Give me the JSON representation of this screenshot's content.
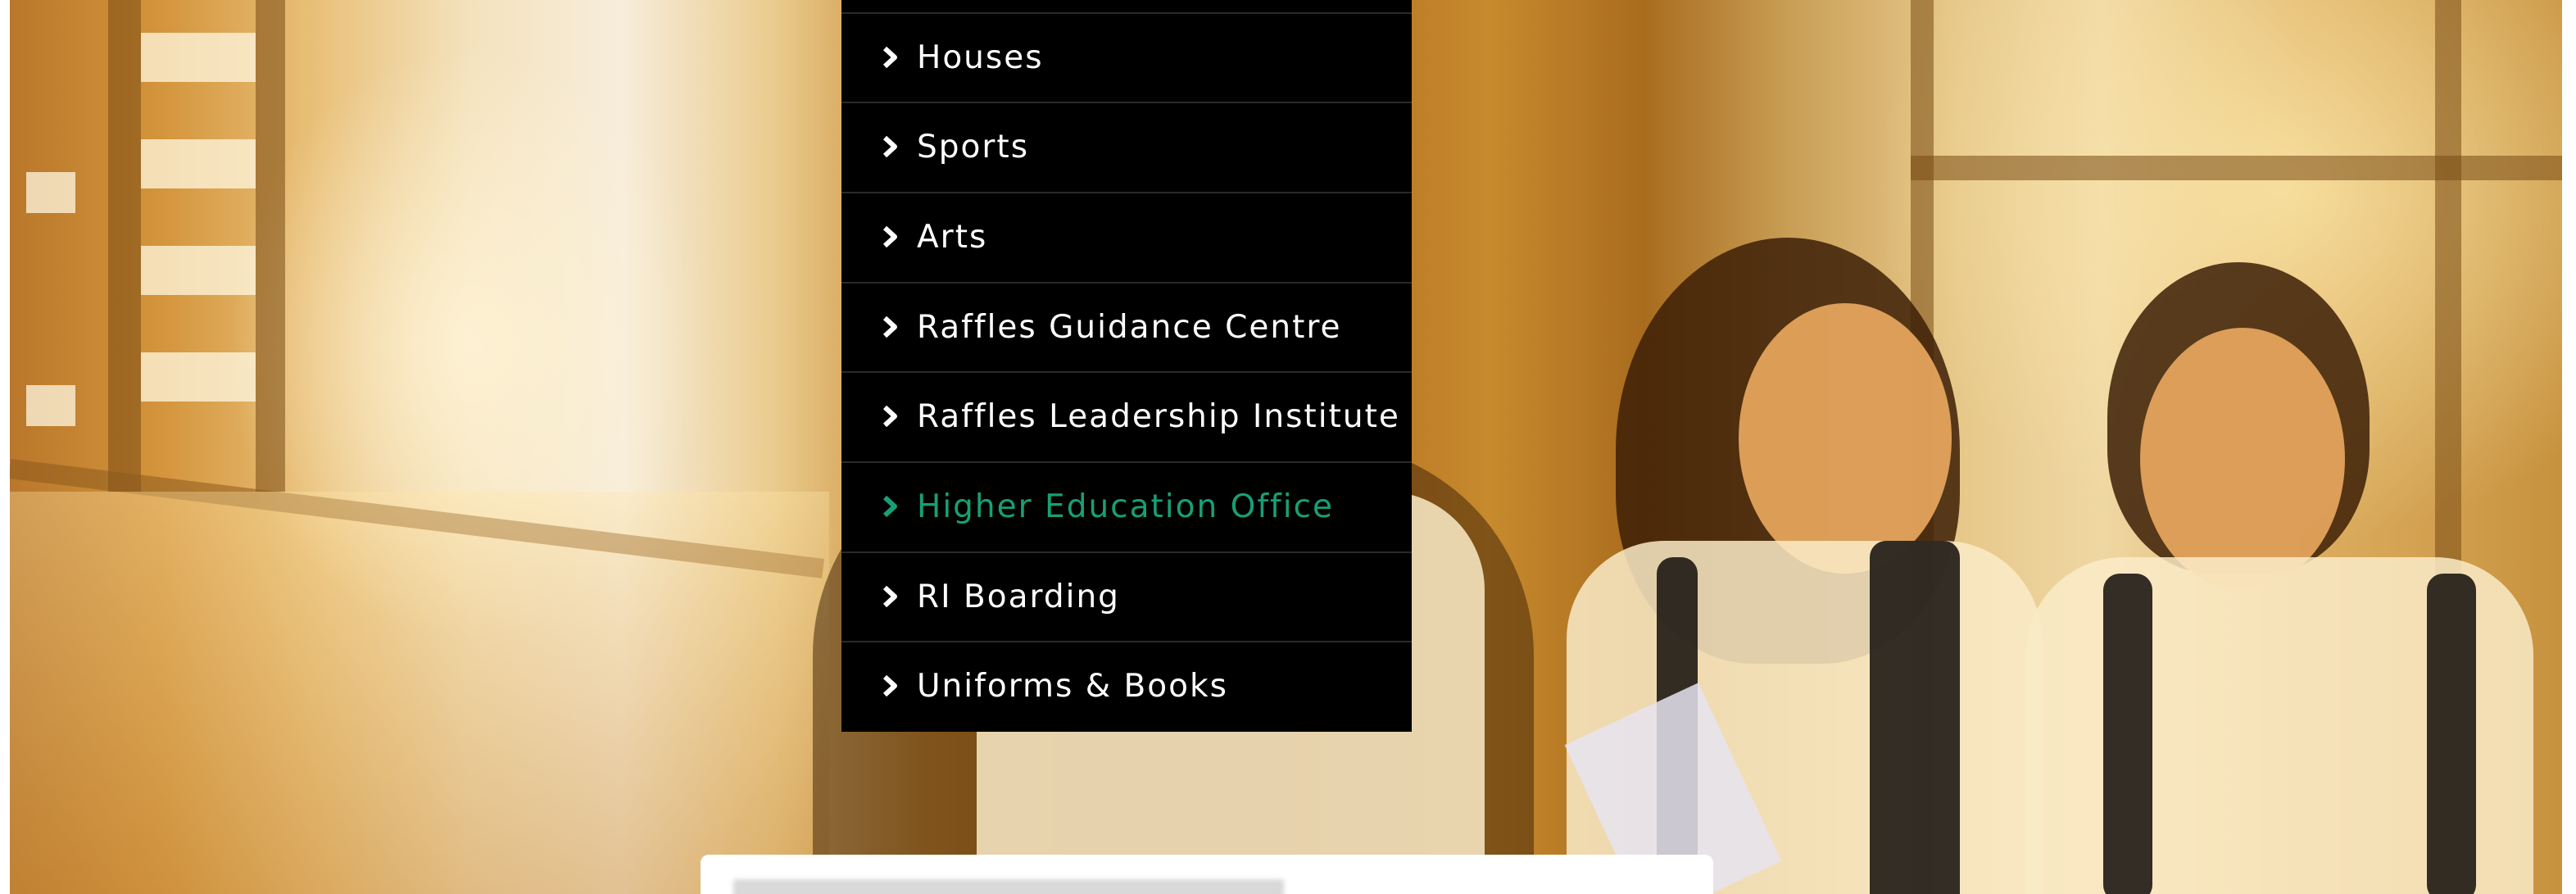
{
  "menu": {
    "items": [
      {
        "label": "Houses",
        "active": false
      },
      {
        "label": "Sports",
        "active": false
      },
      {
        "label": "Arts",
        "active": false
      },
      {
        "label": "Raffles Guidance Centre",
        "active": false
      },
      {
        "label": "Raffles Leadership Institute",
        "active": false
      },
      {
        "label": "Higher Education Office",
        "active": true
      },
      {
        "label": "RI Boarding",
        "active": false
      },
      {
        "label": "Uniforms & Books",
        "active": false
      }
    ]
  },
  "icons": {
    "menu_item_icon": "chevron-right-icon"
  },
  "colors": {
    "menu_background": "#000000",
    "menu_text": "#ffffff",
    "menu_active_text": "#17a075"
  }
}
